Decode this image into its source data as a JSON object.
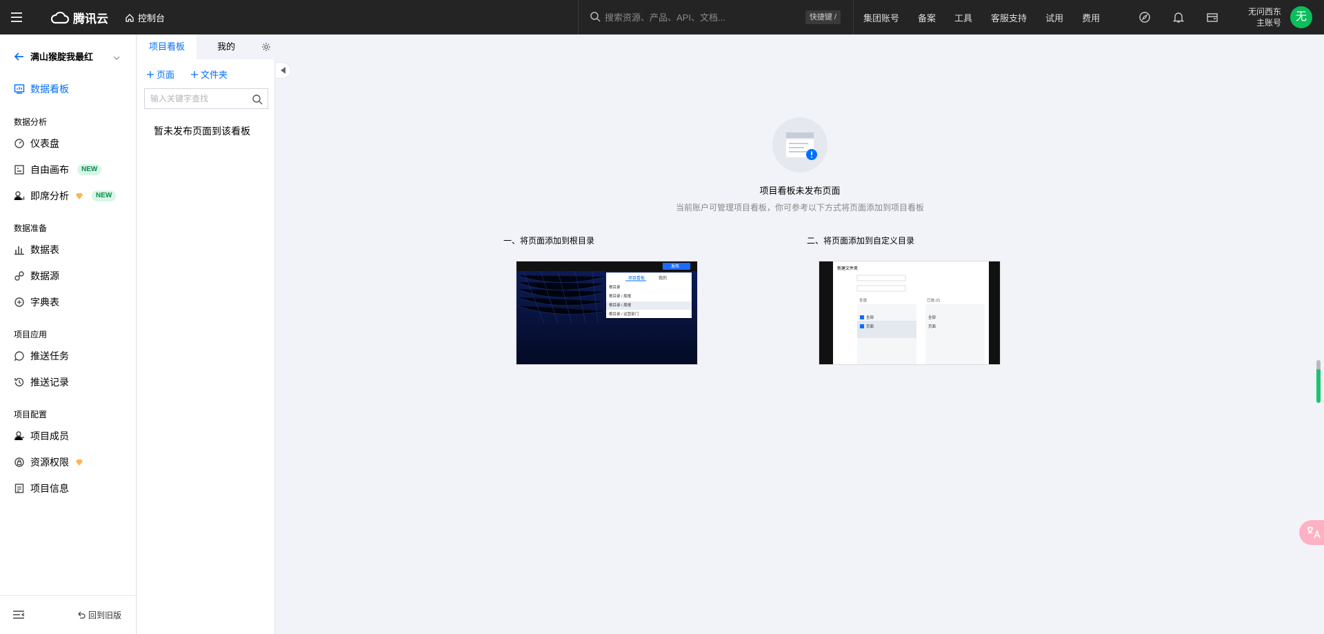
{
  "topbar": {
    "brand": "腾讯云",
    "console": "控制台",
    "search_placeholder": "搜索资源、产品、API、文档...",
    "shortcut": "快捷键 /",
    "nav": [
      "集团账号",
      "备案",
      "工具",
      "客服支持",
      "试用",
      "费用"
    ],
    "user_name": "无问西东",
    "user_role": "主账号",
    "avatar": "无"
  },
  "sidebar": {
    "project": "满山猴腚我最红",
    "active_item": "数据看板",
    "groups": {
      "analysis": {
        "title": "数据分析",
        "items": [
          "仪表盘",
          "自由画布",
          "即席分析"
        ]
      },
      "prep": {
        "title": "数据准备",
        "items": [
          "数据表",
          "数据源",
          "字典表"
        ]
      },
      "app": {
        "title": "项目应用",
        "items": [
          "推送任务",
          "推送记录"
        ]
      },
      "config": {
        "title": "项目配置",
        "items": [
          "项目成员",
          "资源权限",
          "项目信息"
        ]
      }
    },
    "badge_new": "NEW",
    "old_version": "回到旧版"
  },
  "panel": {
    "tabs": [
      "项目看板",
      "我的"
    ],
    "add_page": "页面",
    "add_folder": "文件夹",
    "search_placeholder": "输入关键字查找",
    "empty": "暂未发布页面到该看板"
  },
  "main": {
    "empty_title": "项目看板未发布页面",
    "empty_sub": "当前账户可管理项目看板，你可参考以下方式将页面添加到项目看板",
    "step1": "一、将页面添加到根目录",
    "step2": "二、将页面添加到自定义目录",
    "shot1": {
      "publish": "发布",
      "tabs": [
        "项目看板",
        "我的"
      ],
      "rows": [
        "根目录",
        "根目录 / 局报",
        "根目录 / 周报",
        "根目录 / 运营部门"
      ]
    },
    "shot2": {
      "title": "新建文件夹",
      "left_label": "全选",
      "right_label": "已选 (2)",
      "rows_left": [
        "全部",
        "页面"
      ],
      "rows_right": [
        "全部",
        "页面"
      ]
    }
  },
  "colors": {
    "accent": "#006eff",
    "topbar": "#242424",
    "avatar": "#0abf5b",
    "badge_bg": "#d8f6e6",
    "badge_text": "#0a8a4a"
  }
}
